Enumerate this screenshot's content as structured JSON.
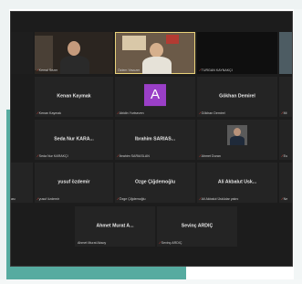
{
  "participants": [
    {
      "tile_name": "",
      "caption": "Kemal Sezer",
      "video": true
    },
    {
      "tile_name": "",
      "caption": "Özlem Yavuzer",
      "video": true
    },
    {
      "tile_name": "",
      "caption": "TURGAN KAYNAKÇI",
      "video": true
    },
    {
      "tile_name": "",
      "caption": "",
      "video": true
    },
    {
      "tile_name": "",
      "caption": "",
      "video": false
    },
    {
      "tile_name": "Kenan Kaymak",
      "caption": "Kenan Kaymak"
    },
    {
      "tile_name": "",
      "caption": "Abidin Yurtseven",
      "avatar_letter": "A"
    },
    {
      "tile_name": "Gökhan Demirel",
      "caption": "Gökhan Demirel"
    },
    {
      "tile_name": "",
      "caption": "Mi"
    },
    {
      "tile_name": "",
      "caption": ""
    },
    {
      "tile_name": "Seda Nur KARA...",
      "caption": "Seda Nur KARAKÇI"
    },
    {
      "tile_name": "İbrahim SARIAS...",
      "caption": "İbrahim SARIASLAN"
    },
    {
      "tile_name": "",
      "caption": "Ahmet Duran",
      "photo": true
    },
    {
      "tile_name": "",
      "caption": "Eu"
    },
    {
      "tile_name": "",
      "caption": "ası"
    },
    {
      "tile_name": "yusuf özdemir",
      "caption": "yusuf özdemir"
    },
    {
      "tile_name": "Özge Çiğdemoğlu",
      "caption": "Özge Çiğdemoğlu"
    },
    {
      "tile_name": "Ali Akbalut Üsk...",
      "caption": "Ali Akbalut Üsküdar yalını"
    },
    {
      "tile_name": "",
      "caption": "Ne"
    },
    {
      "tile_name": "Ahmet Murat A...",
      "caption": "Ahmet Murat Aksoy"
    },
    {
      "tile_name": "Sevinç ARDIÇ",
      "caption": "Sevinç ARDIÇ"
    }
  ],
  "colors": {
    "meeting_bg": "#1c1c1c",
    "tile_bg": "#242424",
    "active_speaker": "#e9d27a",
    "avatar_purple": "#9a3fc7",
    "mic_muted": "#e0453a",
    "deco_teal": "#56aba0"
  },
  "icons": {
    "muted": "mic-muted-icon"
  }
}
